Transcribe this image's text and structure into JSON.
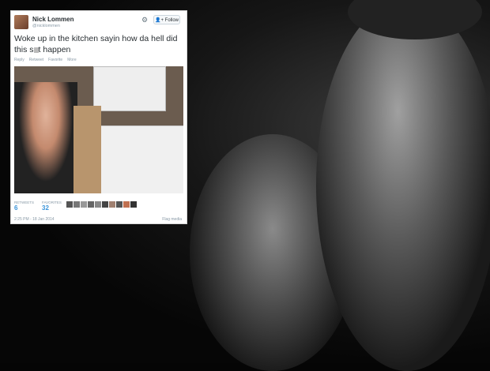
{
  "tweet": {
    "name": "Nick Lommen",
    "handle": "@nicklommen",
    "follow_label": "Follow",
    "text_before": "Woke up in the kitchen sayin how da hell did this s",
    "text_after": "t happen",
    "actions": [
      "Reply",
      "Retweet",
      "Favorite",
      "More"
    ],
    "retweets_label": "RETWEETS",
    "retweets_value": "6",
    "favorites_label": "FAVORITES",
    "favorites_value": "32",
    "timestamp": "2:25 PM - 18 Jan 2014",
    "flag_label": "Flag media"
  },
  "icons": {
    "settings": "gear-icon",
    "follow": "follow-user-icon"
  }
}
